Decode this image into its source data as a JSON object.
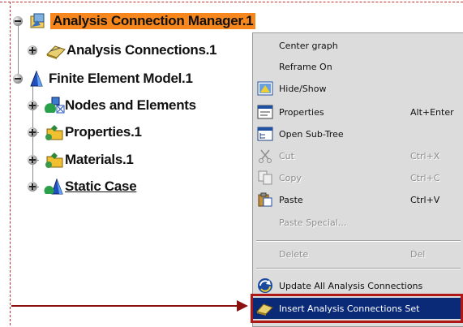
{
  "tree": {
    "nodes": [
      {
        "label": "Analysis Connection Manager.1",
        "icon": "analysis-manager-icon"
      },
      {
        "label": "Analysis Connections.1",
        "icon": "analysis-connections-icon"
      },
      {
        "label": "Finite Element Model.1",
        "icon": "finite-element-model-icon"
      },
      {
        "label": "Nodes and Elements",
        "icon": "nodes-elements-icon"
      },
      {
        "label": "Properties.1",
        "icon": "properties-folder-icon"
      },
      {
        "label": "Materials.1",
        "icon": "materials-folder-icon"
      },
      {
        "label": "Static Case",
        "icon": "static-case-icon"
      }
    ]
  },
  "context_menu": {
    "items": [
      {
        "label": "Center graph",
        "shortcut": ""
      },
      {
        "label": "Reframe On",
        "shortcut": ""
      },
      {
        "label": "Hide/Show",
        "shortcut": "",
        "icon": "hide-show-icon"
      },
      {
        "label": "Properties",
        "shortcut": "Alt+Enter",
        "icon": "properties-icon"
      },
      {
        "label": "Open Sub-Tree",
        "shortcut": "",
        "icon": "open-subtree-icon"
      },
      {
        "label": "Cut",
        "shortcut": "Ctrl+X",
        "icon": "scissors-icon"
      },
      {
        "label": "Copy",
        "shortcut": "Ctrl+C",
        "icon": "copy-icon"
      },
      {
        "label": "Paste",
        "shortcut": "Ctrl+V",
        "icon": "paste-icon"
      },
      {
        "label": "Paste Special...",
        "shortcut": ""
      },
      {
        "label": "Delete",
        "shortcut": "Del"
      },
      {
        "label": "Update All Analysis Connections",
        "shortcut": "",
        "icon": "update-icon"
      },
      {
        "label": "Insert Analysis Connections Set",
        "shortcut": "",
        "icon": "insert-connections-icon"
      }
    ]
  },
  "colors": {
    "selection": "#f7861c",
    "menu_hover": "#0a2a78",
    "annotation": "#b01818"
  }
}
